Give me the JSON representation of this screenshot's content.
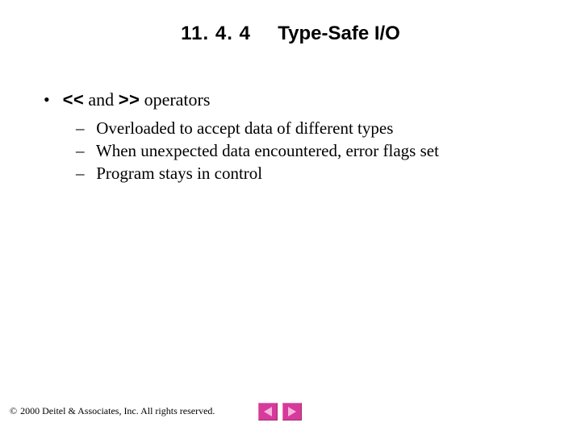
{
  "title": {
    "number": "11. 4. 4",
    "text": "Type-Safe I/O"
  },
  "bullet": {
    "op_left": "<<",
    "conj": " and ",
    "op_right": ">>",
    "tail": " operators"
  },
  "subs": [
    "Overloaded to accept data of different types",
    "When unexpected data encountered, error flags set",
    "Program stays in control"
  ],
  "footer": {
    "copyright_symbol": "©",
    "text": " 2000 Deitel & Associates, Inc.  All rights reserved."
  }
}
